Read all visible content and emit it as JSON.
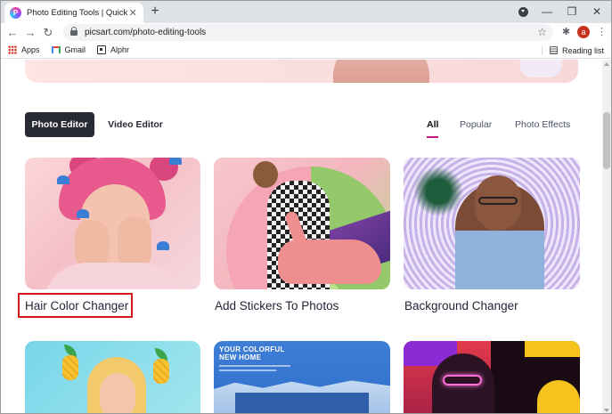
{
  "browser": {
    "tab_title": "Photo Editing Tools | Quick & Eas",
    "favicon_letter": "P",
    "tab_close": "✕",
    "new_tab": "+",
    "window_minimize": "—",
    "window_maximize": "❐",
    "window_close": "✕",
    "url": "picsart.com/photo-editing-tools",
    "back": "←",
    "forward": "→",
    "reload": "↻",
    "bookmark_star": "☆",
    "extensions_icon": "puzzle-icon",
    "profile_letter": "a",
    "menu": "⋮"
  },
  "bookmarks": {
    "items": [
      {
        "label": "Apps",
        "icon": "apps-grid-icon"
      },
      {
        "label": "Gmail",
        "icon": "gmail-icon"
      },
      {
        "label": "Alphr",
        "icon": "alphr-icon"
      }
    ],
    "reading_list": "Reading list"
  },
  "page": {
    "editor_tabs": [
      {
        "label": "Photo Editor",
        "active": true
      },
      {
        "label": "Video Editor",
        "active": false
      }
    ],
    "filters": [
      {
        "label": "All",
        "active": true
      },
      {
        "label": "Popular",
        "active": false
      },
      {
        "label": "Photo Effects",
        "active": false
      }
    ],
    "tools": [
      {
        "title": "Hair Color Changer",
        "highlighted": true
      },
      {
        "title": "Add Stickers To Photos",
        "highlighted": false
      },
      {
        "title": "Background Changer",
        "highlighted": false
      }
    ],
    "card5_headline": "YOUR COLORFUL\nNEW HOME",
    "colors": {
      "active_tab_bg": "#282a33",
      "filter_underline": "#c2148b",
      "highlight_box": "#d0191b"
    }
  }
}
